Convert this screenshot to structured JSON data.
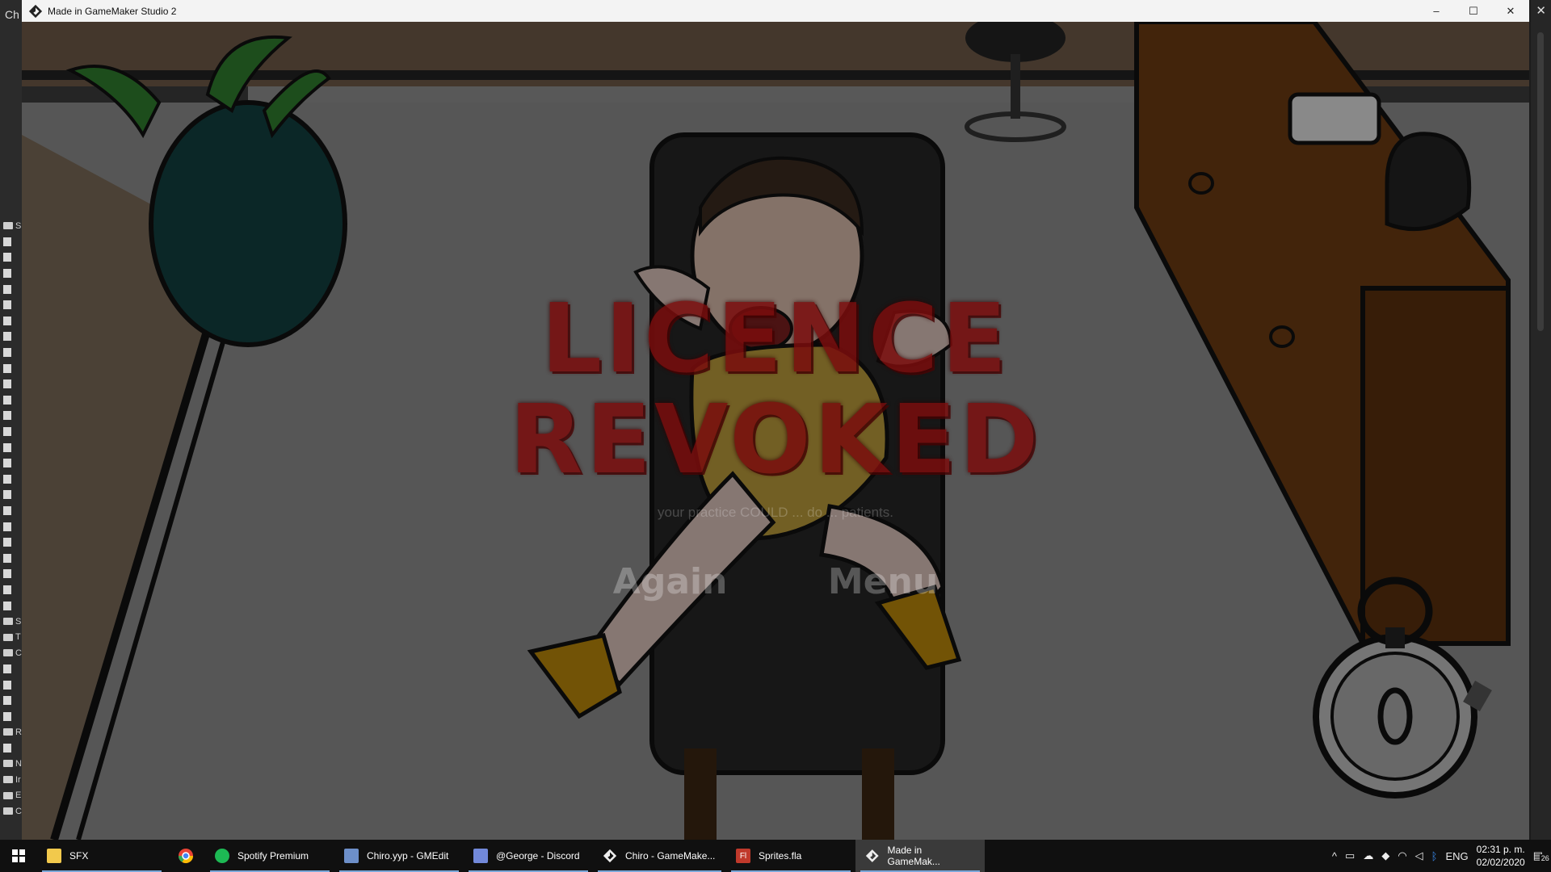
{
  "background_app": {
    "title_fragment": "Ch",
    "tree_letters": [
      "S",
      "S",
      "T",
      "C",
      "R",
      "N",
      "Ir",
      "E",
      "C"
    ]
  },
  "window": {
    "title": "Made in GameMaker Studio 2",
    "controls": {
      "minimize": "–",
      "maximize": "☐",
      "close": "✕"
    }
  },
  "game": {
    "headline_line1": "LICENCE",
    "headline_line2": "REVOKED",
    "subtitle": "your practice COULD ... do ... patients.",
    "menu": [
      {
        "label": "Again"
      },
      {
        "label": "Menu"
      }
    ]
  },
  "taskbar": {
    "items": [
      {
        "label": "SFX",
        "icon": "folder-icon",
        "color": "#f2c94c",
        "open": true,
        "active": false
      },
      {
        "label": "",
        "icon": "chrome-icon",
        "color": "#e94335",
        "open": false,
        "active": false
      },
      {
        "label": "Spotify Premium",
        "icon": "spotify-icon",
        "color": "#1db954",
        "open": true,
        "active": false
      },
      {
        "label": "Chiro.yyp - GMEdit",
        "icon": "gmedit-icon",
        "color": "#6d8fc9",
        "open": true,
        "active": false
      },
      {
        "label": "@George - Discord",
        "icon": "discord-icon",
        "color": "#7289da",
        "open": true,
        "active": false
      },
      {
        "label": "Chiro - GameMake...",
        "icon": "gamemaker-icon",
        "color": "#e8e8e8",
        "open": true,
        "active": false
      },
      {
        "label": "Sprites.fla",
        "icon": "flash-icon",
        "color": "#c0392b",
        "open": true,
        "active": false
      },
      {
        "label": "Made in GameMak...",
        "icon": "gamemaker-icon",
        "color": "#e8e8e8",
        "open": true,
        "active": true
      }
    ],
    "tray": {
      "language": "ENG",
      "time": "02:31 p. m.",
      "date": "02/02/2020",
      "notifications": "26"
    }
  }
}
